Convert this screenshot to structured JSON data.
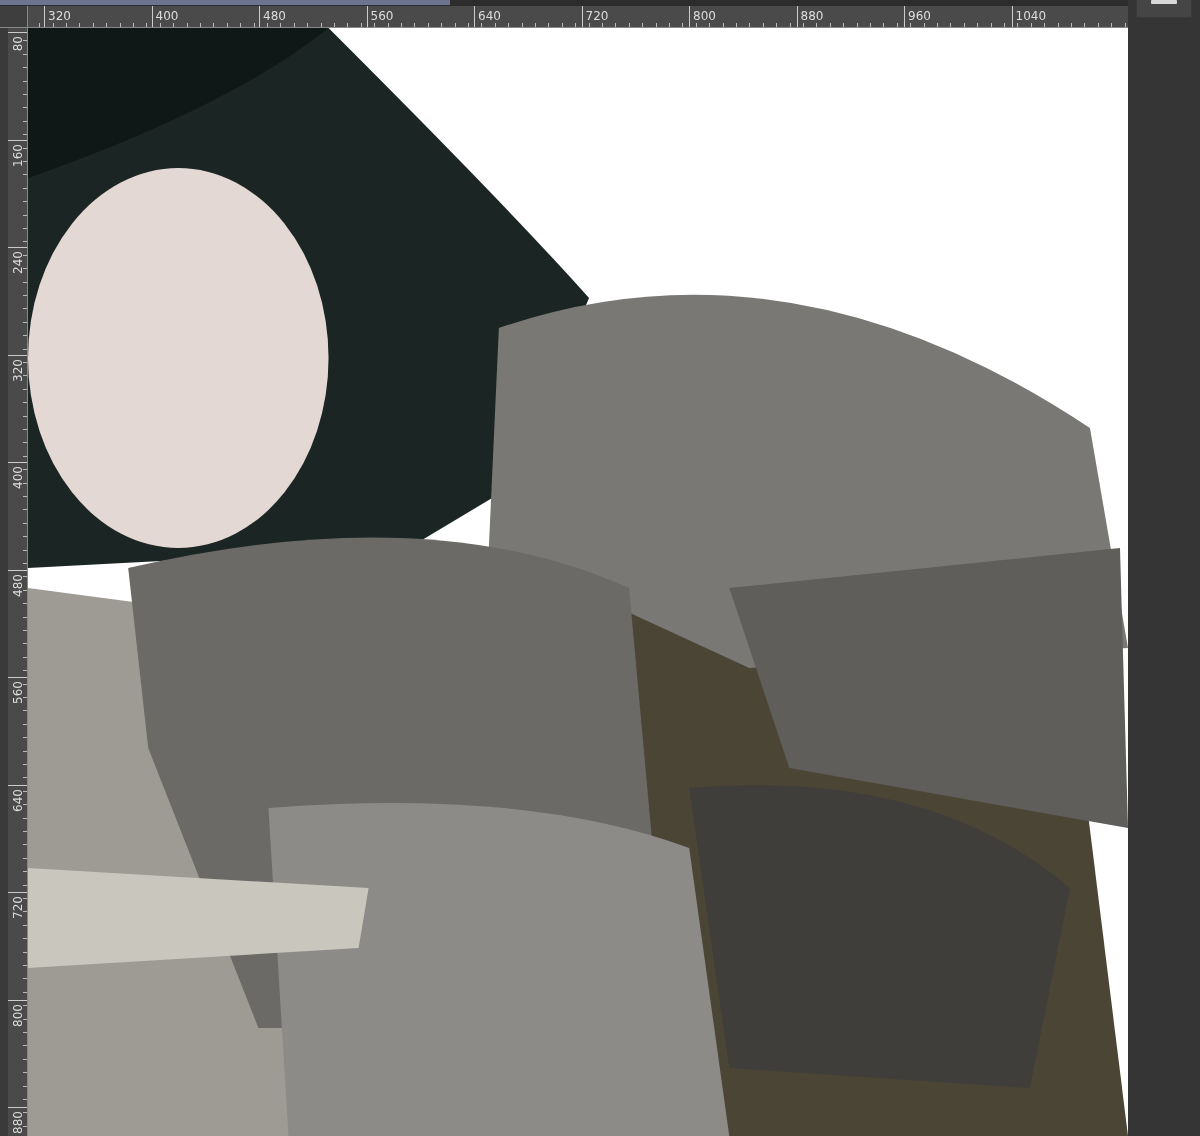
{
  "top_ruler": {
    "labels": [
      "320",
      "400",
      "480",
      "560",
      "640",
      "720",
      "800",
      "880",
      "960",
      "1040"
    ]
  },
  "left_ruler": {
    "labels": [
      "80",
      "160",
      "240",
      "320",
      "400",
      "480",
      "560",
      "640",
      "720",
      "800",
      "880"
    ]
  }
}
